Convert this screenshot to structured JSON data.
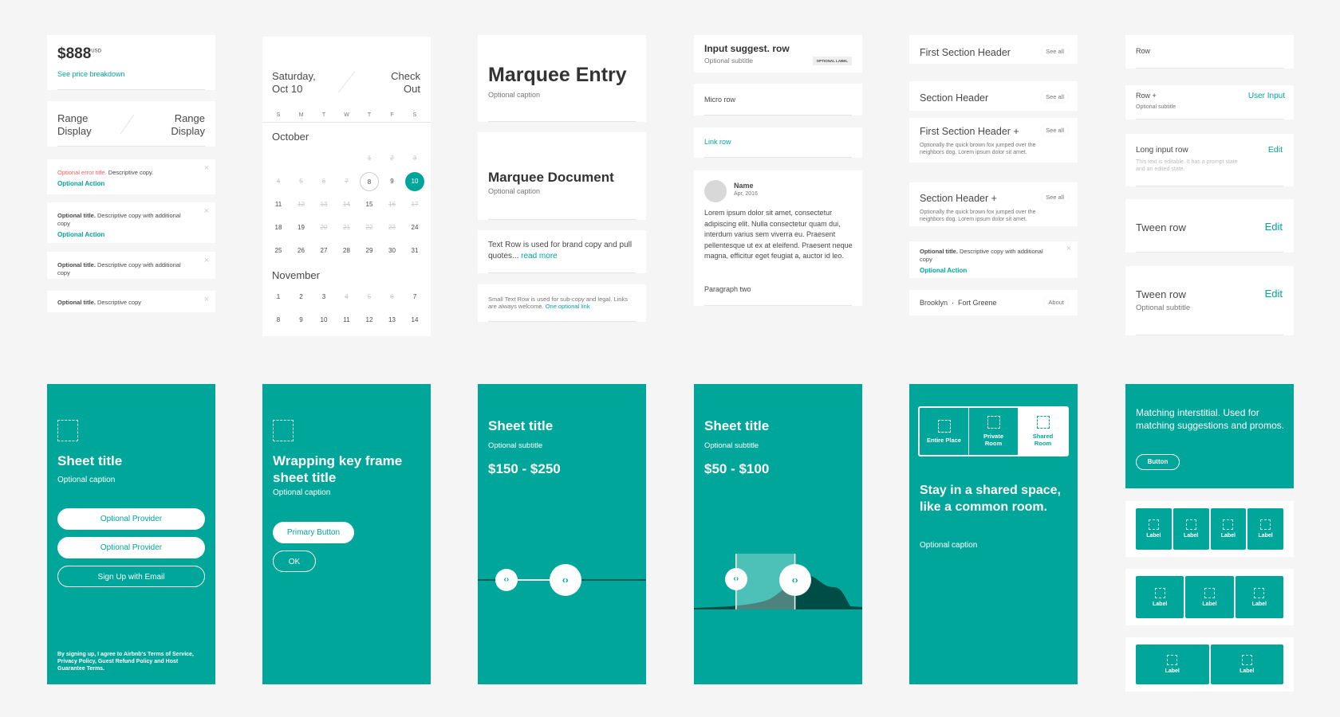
{
  "colors": {
    "teal": "#00A699",
    "error": "#FF5A5F",
    "text": "#484848"
  },
  "col1": {
    "price": "$888",
    "currency": "USD",
    "price_link": "See price breakdown",
    "range_left": "Range\nDisplay",
    "range_right": "Range\nDisplay",
    "alerts": [
      {
        "title": "Optional error title.",
        "copy": " Descriptive copy.",
        "action": "Optional Action"
      },
      {
        "title": "Optional title.",
        "copy": " Descriptive copy with additional copy",
        "action": "Optional Action"
      },
      {
        "title": "Optional title.",
        "copy": " Descriptive copy with additional copy"
      },
      {
        "title": "Optional title.",
        "copy": " Descriptive copy"
      }
    ],
    "close_icon": "×"
  },
  "calendar": {
    "check_in": "Saturday,\nOct 10",
    "check_out": "Check\nOut",
    "weekdays": [
      "S",
      "M",
      "T",
      "W",
      "T",
      "F",
      "S"
    ],
    "months": [
      {
        "name": "October",
        "weeks": [
          [
            {
              "d": ""
            },
            {
              "d": ""
            },
            {
              "d": ""
            },
            {
              "d": ""
            },
            {
              "d": "1",
              "s": "f"
            },
            {
              "d": "2",
              "s": "f"
            },
            {
              "d": "3",
              "s": "f"
            }
          ],
          [
            {
              "d": "4",
              "s": "f"
            },
            {
              "d": "5",
              "s": "f"
            },
            {
              "d": "6",
              "s": "f"
            },
            {
              "d": "7",
              "s": "f"
            },
            {
              "d": "8",
              "s": "o"
            },
            {
              "d": "9"
            },
            {
              "d": "10",
              "s": "sel"
            }
          ],
          [
            {
              "d": "11"
            },
            {
              "d": "12",
              "s": "f"
            },
            {
              "d": "13",
              "s": "f"
            },
            {
              "d": "14",
              "s": "f"
            },
            {
              "d": "15"
            },
            {
              "d": "16",
              "s": "f"
            },
            {
              "d": "17",
              "s": "f"
            }
          ],
          [
            {
              "d": "18"
            },
            {
              "d": "19"
            },
            {
              "d": "20",
              "s": "f"
            },
            {
              "d": "21",
              "s": "f"
            },
            {
              "d": "22",
              "s": "f"
            },
            {
              "d": "23",
              "s": "f"
            },
            {
              "d": "24"
            }
          ],
          [
            {
              "d": "25"
            },
            {
              "d": "26"
            },
            {
              "d": "27"
            },
            {
              "d": "28"
            },
            {
              "d": "29"
            },
            {
              "d": "30"
            },
            {
              "d": "31"
            }
          ]
        ]
      },
      {
        "name": "November",
        "weeks": [
          [
            {
              "d": "1"
            },
            {
              "d": "2"
            },
            {
              "d": "3"
            },
            {
              "d": "4",
              "s": "f"
            },
            {
              "d": "5",
              "s": "f"
            },
            {
              "d": "6",
              "s": "f"
            },
            {
              "d": "7"
            }
          ],
          [
            {
              "d": "8"
            },
            {
              "d": "9"
            },
            {
              "d": "10"
            },
            {
              "d": "11"
            },
            {
              "d": "12"
            },
            {
              "d": "13"
            },
            {
              "d": "14"
            }
          ]
        ]
      }
    ]
  },
  "col3": {
    "marquee_entry": "Marquee Entry",
    "marquee_entry_caption": "Optional caption",
    "marquee_doc": "Marquee Document",
    "marquee_doc_caption": "Optional caption",
    "text_row": "Text Row is used for brand copy and pull quotes... ",
    "text_row_link": "read more",
    "small_text_row": "Small Text Row is used for sub-copy and legal. Links are always welcome. ",
    "small_text_link": "One optional link"
  },
  "col4": {
    "input_suggest": "Input suggest. row",
    "input_suggest_sub": "Optional subtitle",
    "optional_label": "OPTIONAL LABEL",
    "micro_row": "Micro row",
    "link_row": "Link row",
    "review_name": "Name",
    "review_date": "Apr, 2016",
    "review_body": "Lorem ipsum dolor sit amet, consectetur adipiscing elit. Nulla consectetur quam dui, interdum varius sem viverra eu. Praesent pellentesque ut ex at eleifend. Praesent neque magna, efficitur eget feugiat a, auctor id leo.",
    "review_p2": "Paragraph two"
  },
  "col5": {
    "first_section_header": "First Section Header",
    "section_header": "Section Header",
    "first_section_header_plus": "First Section Header +",
    "section_header_plus": "Section Header +",
    "see_all": "See all",
    "header_desc": "Optionally the quick brown fox jumped over the neighbors dog. Lorem ipsum dolor sit amet.",
    "alert": {
      "title": "Optional title.",
      "copy": " Descriptive copy with additional copy",
      "action": "Optional Action"
    },
    "location": "Brooklyn  ·  Fort Greene",
    "about": "About"
  },
  "col6": {
    "row": "Row",
    "row_plus": "Row +",
    "row_plus_sub": "Optional subtitle",
    "user_input": "User Input",
    "long_input": "Long input row",
    "long_input_text": "This text is editable. It has a prompt state and an edited state.",
    "edit": "Edit",
    "tween": "Tween row",
    "tween2": "Tween row",
    "tween2_sub": "Optional subtitle"
  },
  "sheets": {
    "s1": {
      "title": "Sheet title",
      "caption": "Optional caption",
      "btn1": "Optional Provider",
      "btn2": "Optional Provider",
      "btn3": "Sign Up with Email",
      "legal": "By signing up, I agree to Airbnb's Terms of Service, Privacy Policy, Guest Refund Policy and Host Guarantee Terms."
    },
    "s2": {
      "title": "Wrapping key frame sheet title",
      "caption": "Optional caption",
      "primary": "Primary Button",
      "ok": "OK"
    },
    "s3": {
      "title": "Sheet title",
      "subtitle": "Optional subtitle",
      "range": "$150 - $250",
      "handle_positions": [
        0.17,
        0.52
      ]
    },
    "s4": {
      "title": "Sheet title",
      "subtitle": "Optional subtitle",
      "range": "$50 - $100",
      "handle_positions": [
        0.25,
        0.6
      ]
    },
    "s5": {
      "options": [
        "Entire Place",
        "Private Room",
        "Shared Room"
      ],
      "selected": "Shared Room",
      "headline": "Stay in a shared space, like a common room.",
      "caption": "Optional caption"
    },
    "s6": {
      "interstitial": "Matching interstitial. Used for matching suggestions and promos.",
      "button": "Button",
      "tile_rows": [
        [
          "Label",
          "Label",
          "Label",
          "Label"
        ],
        [
          "Label",
          "Label",
          "Label"
        ],
        [
          "Label",
          "Label"
        ]
      ]
    }
  }
}
